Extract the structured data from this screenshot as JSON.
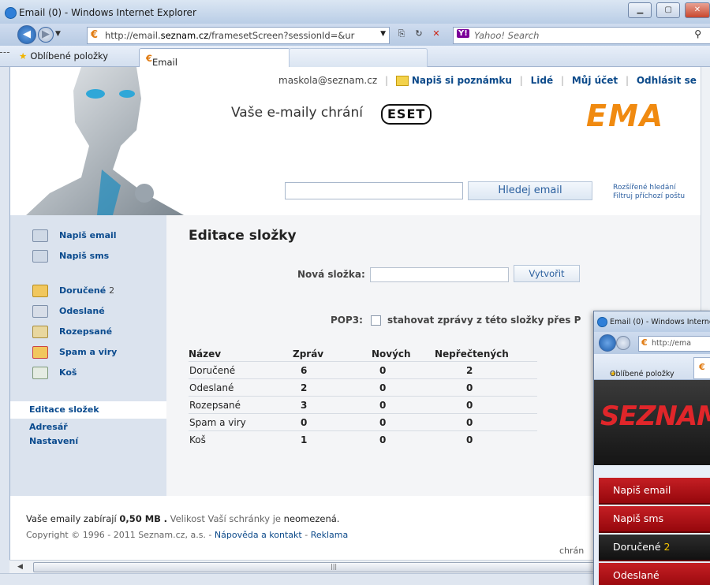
{
  "browser": {
    "window_title": "Email (0) - Windows Internet Explorer",
    "url_prefix": "http://email.",
    "url_domain": "seznam.cz",
    "url_suffix": "/framesetScreen?sessionId=&ur",
    "search_placeholder": "Yahoo! Search",
    "search_brand": "Y!",
    "favorites_label": "Oblíbené položky",
    "tab_label": "Email (0)"
  },
  "header": {
    "user_email": "maskola@seznam.cz",
    "links": [
      "Napiš si poznámku",
      "Lidé",
      "Můj účet",
      "Odhlásit se"
    ],
    "slogan": "Vaše e-maily chrání",
    "eset_logo": "ESET",
    "brand_partial": "EMA",
    "search_button": "Hledej email",
    "advanced_search": "Rozšířené hledání",
    "filter_incoming": "Filtruj příchozí poštu"
  },
  "sidebar": {
    "actions": [
      {
        "label": "Napiš email",
        "icon": "compose-email-icon"
      },
      {
        "label": "Napiš sms",
        "icon": "compose-sms-icon"
      }
    ],
    "folders": [
      {
        "label": "Doručené",
        "count": "2",
        "icon": "inbox-folder-icon"
      },
      {
        "label": "Odeslané",
        "count": "",
        "icon": "sent-folder-icon"
      },
      {
        "label": "Rozepsané",
        "count": "",
        "icon": "drafts-folder-icon"
      },
      {
        "label": "Spam a viry",
        "count": "",
        "icon": "spam-folder-icon"
      },
      {
        "label": "Koš",
        "count": "",
        "icon": "trash-icon"
      }
    ],
    "nav": [
      {
        "label": "Editace složek",
        "active": true
      },
      {
        "label": "Adresář",
        "active": false
      },
      {
        "label": "Nastavení",
        "active": false
      }
    ]
  },
  "content": {
    "title": "Editace složky",
    "new_folder_label": "Nová složka:",
    "create_button": "Vytvořit",
    "pop3_label": "POP3:",
    "pop3_text": "stahovat zprávy z této složky přes P",
    "table": {
      "headers": [
        "Název",
        "Zpráv",
        "Nových",
        "Nepřečtených"
      ],
      "rows": [
        [
          "Doručené",
          "6",
          "0",
          "2"
        ],
        [
          "Odeslané",
          "2",
          "0",
          "0"
        ],
        [
          "Rozepsané",
          "3",
          "0",
          "0"
        ],
        [
          "Spam a viry",
          "0",
          "0",
          "0"
        ],
        [
          "Koš",
          "1",
          "0",
          "0"
        ]
      ]
    }
  },
  "footer": {
    "usage_prefix": "Vaše emaily zabírají",
    "usage_value": "0,50 MB",
    "usage_dot": ".",
    "capacity_prefix": "Velikost Vaší schránky je",
    "capacity_value": "neomezená.",
    "copyright": "Copyright © 1996 - 2011 Seznam.cz, a.s. -",
    "help_link": "Nápověda a kontakt",
    "dash": "-",
    "ads_link": "Reklama",
    "protected_partial": "chrán"
  },
  "second_window": {
    "title": "Email (0) - Windows Interne",
    "url": "http://ema",
    "favorites_label": "Oblíbené položky",
    "logo": "SEZNAM",
    "menu": [
      {
        "label": "Napiš email",
        "count": ""
      },
      {
        "label": "Napiš sms",
        "count": ""
      },
      {
        "label": "Doručené",
        "count": "2"
      },
      {
        "label": "Odeslané",
        "count": ""
      }
    ]
  },
  "colors": {
    "link_blue": "#0c4a8a",
    "eset_orange": "#f08a10",
    "seznam_red": "#c51f24",
    "sidebar_bg": "#dbe3ee"
  }
}
